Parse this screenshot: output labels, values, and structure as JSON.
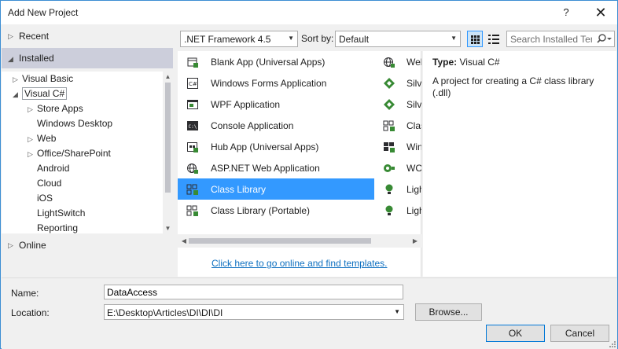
{
  "window": {
    "title": "Add New Project",
    "help_glyph": "?",
    "close_glyph": "✕",
    "accent_color": "#3c8ed3"
  },
  "nav": {
    "recent": "Recent",
    "installed": "Installed",
    "online": "Online"
  },
  "tree": [
    {
      "label": "Visual Basic",
      "expanded": false,
      "level": 0
    },
    {
      "label": "Visual C#",
      "expanded": true,
      "level": 0,
      "selected": true
    },
    {
      "label": "Store Apps",
      "expanded": false,
      "level": 1
    },
    {
      "label": "Windows Desktop",
      "level": 1
    },
    {
      "label": "Web",
      "expanded": false,
      "level": 1
    },
    {
      "label": "Office/SharePoint",
      "expanded": false,
      "level": 1
    },
    {
      "label": "Android",
      "level": 1
    },
    {
      "label": "Cloud",
      "level": 1
    },
    {
      "label": "iOS",
      "level": 1
    },
    {
      "label": "LightSwitch",
      "level": 1
    },
    {
      "label": "Reporting",
      "level": 1
    }
  ],
  "toolbar": {
    "framework": ".NET Framework 4.5",
    "sort_label": "Sort by:",
    "sort_value": "Default",
    "search_placeholder": "Search Installed Templates"
  },
  "templates": [
    {
      "label": "Blank App (Universal Apps)",
      "icon": "universal-app-icon"
    },
    {
      "label": "Windows Forms Application",
      "icon": "winforms-icon"
    },
    {
      "label": "WPF Application",
      "icon": "wpf-icon"
    },
    {
      "label": "Console Application",
      "icon": "console-icon"
    },
    {
      "label": "Hub App (Universal Apps)",
      "icon": "hub-app-icon"
    },
    {
      "label": "ASP.NET Web Application",
      "icon": "aspnet-icon"
    },
    {
      "label": "Class Library",
      "icon": "class-library-icon",
      "selected": true
    },
    {
      "label": "Class Library (Portable)",
      "icon": "portable-library-icon"
    }
  ],
  "templates_col2": [
    {
      "label": "Web",
      "icon": "web-globe-icon"
    },
    {
      "label": "Silve",
      "icon": "silverlight-icon"
    },
    {
      "label": "Silve",
      "icon": "silverlight-icon"
    },
    {
      "label": "Class",
      "icon": "class-library-icon"
    },
    {
      "label": "Win",
      "icon": "windows-icon"
    },
    {
      "label": "WC",
      "icon": "wcf-icon"
    },
    {
      "label": "Ligh",
      "icon": "lightswitch-icon"
    },
    {
      "label": "Ligh",
      "icon": "lightswitch-icon"
    }
  ],
  "online_link": "Click here to go online and find templates.",
  "details": {
    "type_key": "Type:",
    "type_value": "Visual C#",
    "description": "A project for creating a C# class library (.dll)"
  },
  "form": {
    "name_label": "Name:",
    "name_value": "DataAccess",
    "location_label": "Location:",
    "location_value": "E:\\Desktop\\Articles\\DI\\DI\\DI",
    "browse": "Browse...",
    "ok": "OK",
    "cancel": "Cancel"
  },
  "colors": {
    "selection": "#3399ff",
    "installed_bg": "#cccedb",
    "link": "#0e70c0"
  }
}
